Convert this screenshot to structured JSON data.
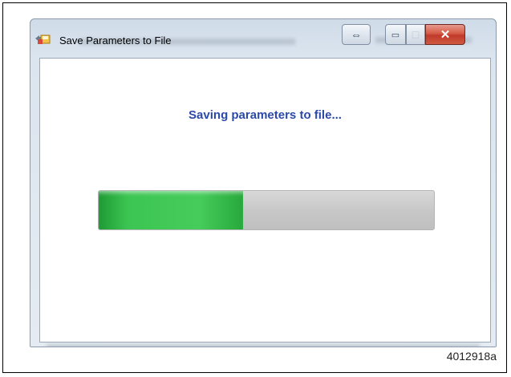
{
  "window": {
    "title": "Save Parameters to File",
    "icon": "save-file-icon",
    "controls": {
      "resize_icon": "⇔",
      "minimize_icon": "▭",
      "maximize_icon": "□",
      "close_icon": "✕"
    }
  },
  "dialog": {
    "message": "Saving parameters to file...",
    "progress_fraction": 0.43,
    "progress_color": "#3cc552"
  },
  "caption": "4012918a"
}
